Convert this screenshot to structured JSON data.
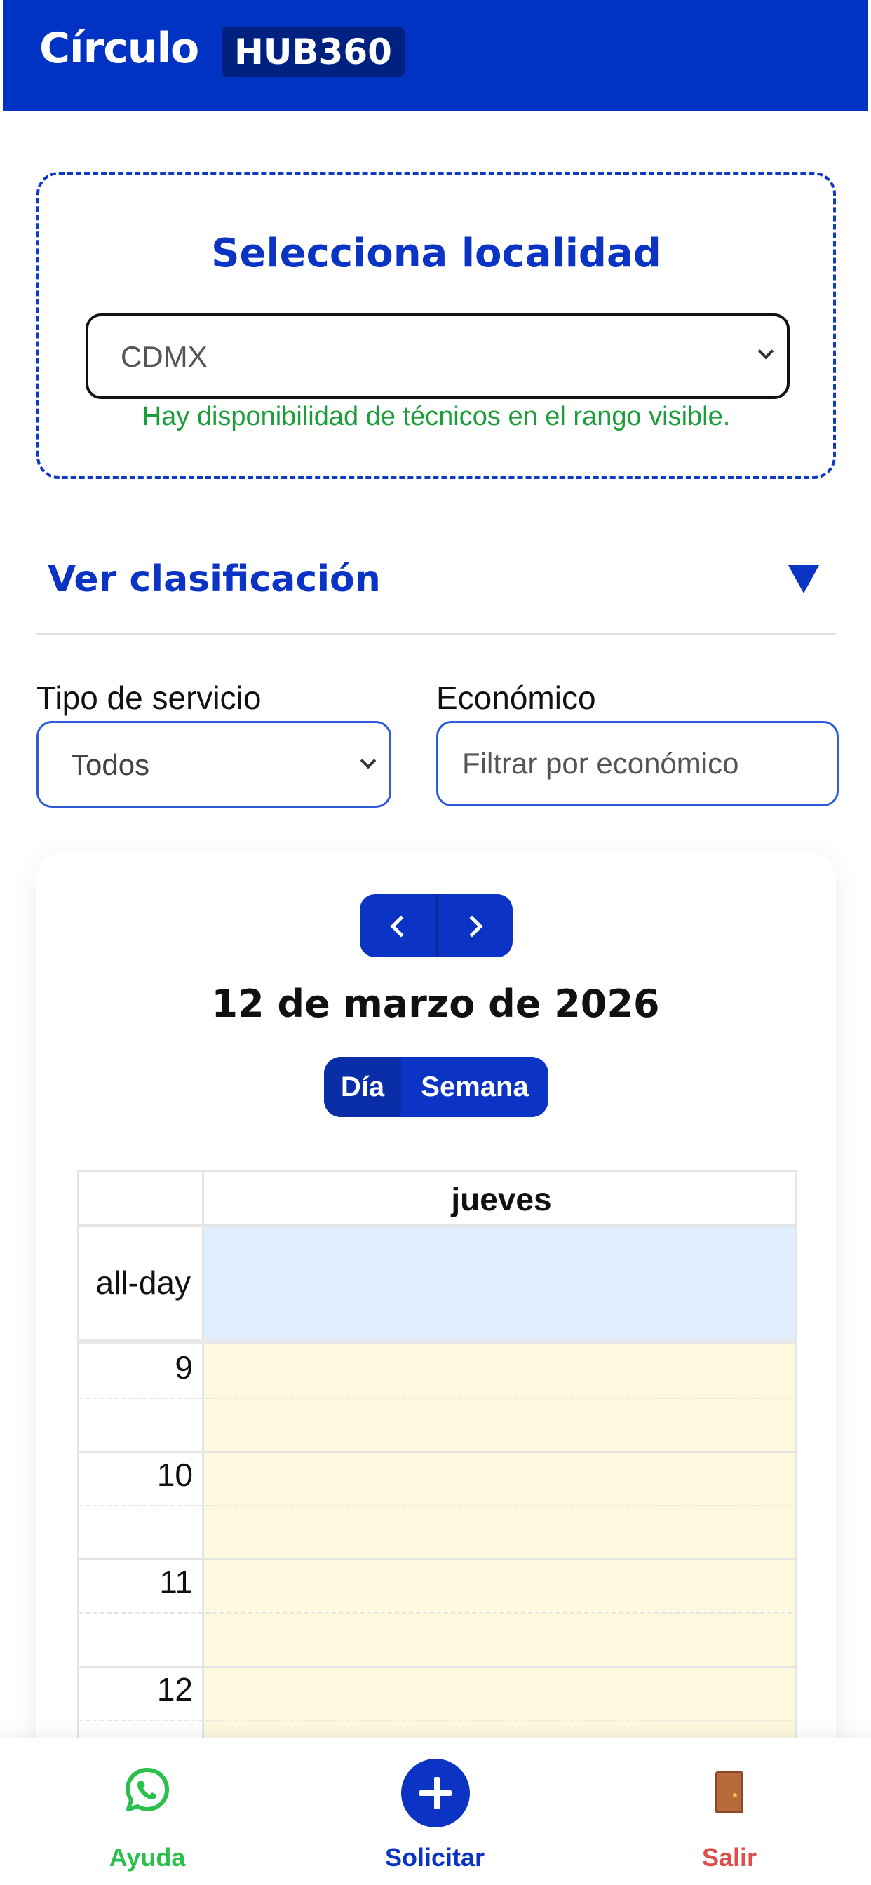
{
  "header": {
    "brand": "Círculo",
    "badge": "HUB360"
  },
  "locality": {
    "title": "Selecciona localidad",
    "selected": "CDMX",
    "status": "Hay disponibilidad de técnicos en el rango visible."
  },
  "classification": {
    "label": "Ver clasificación"
  },
  "filters": {
    "service_label": "Tipo de servicio",
    "service_value": "Todos",
    "economic_label": "Económico",
    "economic_placeholder": "Filtrar por económico"
  },
  "calendar": {
    "date_title": "12 de marzo de 2026",
    "view_day": "Día",
    "view_week": "Semana",
    "day_header": "jueves",
    "allday_label": "all-day",
    "hours": [
      "9",
      "10",
      "11",
      "12"
    ]
  },
  "bottom_nav": {
    "help": "Ayuda",
    "request": "Solicitar",
    "exit": "Salir"
  },
  "colors": {
    "primary": "#0b34c4",
    "success": "#1b9e3a",
    "danger": "#e24b4b",
    "allday_bg": "#dfeffd",
    "slot_bg": "#fdf8de"
  }
}
